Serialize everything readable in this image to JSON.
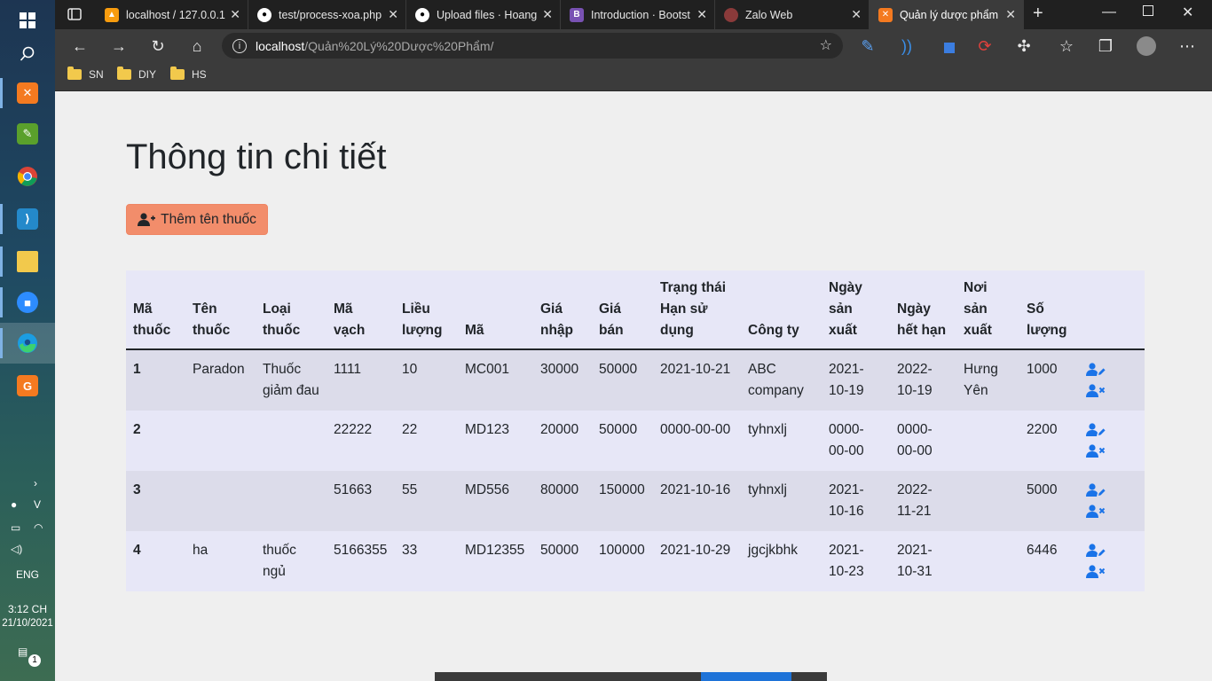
{
  "taskbar": {
    "language": "ENG",
    "time": "3:12 CH",
    "date": "21/10/2021",
    "notification_count": "1"
  },
  "browser": {
    "tabs": [
      {
        "title": "localhost / 127.0.0.1",
        "favicon": "phpmyadmin-icon"
      },
      {
        "title": "test/process-xoa.php",
        "favicon": "github-icon"
      },
      {
        "title": "Upload files · Hoang",
        "favicon": "github-icon"
      },
      {
        "title": "Introduction · Bootst",
        "favicon": "bootstrap-icon"
      },
      {
        "title": "Zalo Web",
        "favicon": "zalo-icon"
      },
      {
        "title": "Quản lý dược phẩm",
        "favicon": "xampp-icon"
      }
    ],
    "url_host": "localhost",
    "url_path": "/Quản%20Lý%20Dược%20Phẩm/",
    "bookmarks": [
      "SN",
      "DIY",
      "HS"
    ]
  },
  "page": {
    "title": "Thông tin chi tiết",
    "add_button_label": "Thêm tên thuốc",
    "accent_button_color": "#f28d6b",
    "action_icon_color": "#1a73e8"
  },
  "table": {
    "headers": [
      "Mã thuốc",
      "Tên thuốc",
      "Loại thuốc",
      "Mã vạch",
      "Liều lượng",
      "Mã",
      "Giá nhập",
      "Giá bán",
      "Trạng thái Hạn sử dụng",
      "Công ty",
      "Ngày sản xuất",
      "Ngày hết hạn",
      "Nơi sản xuất",
      "Số lượng"
    ],
    "rows": [
      [
        "1",
        "Paradon",
        "Thuốc giảm đau",
        "1111",
        "10",
        "MC001",
        "30000",
        "50000",
        "2021-10-21",
        "ABC company",
        "2021-10-19",
        "2022-10-19",
        "Hưng Yên",
        "1000"
      ],
      [
        "2",
        "",
        "",
        "22222",
        "22",
        "MD123",
        "20000",
        "50000",
        "0000-00-00",
        "tyhnxlj",
        "0000-00-00",
        "0000-00-00",
        "",
        "2200"
      ],
      [
        "3",
        "",
        "",
        "51663",
        "55",
        "MD556",
        "80000",
        "150000",
        "2021-10-16",
        "tyhnxlj",
        "2021-10-16",
        "2022-11-21",
        "",
        "5000"
      ],
      [
        "4",
        "ha",
        "thuốc ngủ",
        "5166355",
        "33",
        "MD12355",
        "50000",
        "100000",
        "2021-10-29",
        "jgcjkbhk",
        "2021-10-23",
        "2021-10-31",
        "",
        "6446"
      ]
    ]
  }
}
